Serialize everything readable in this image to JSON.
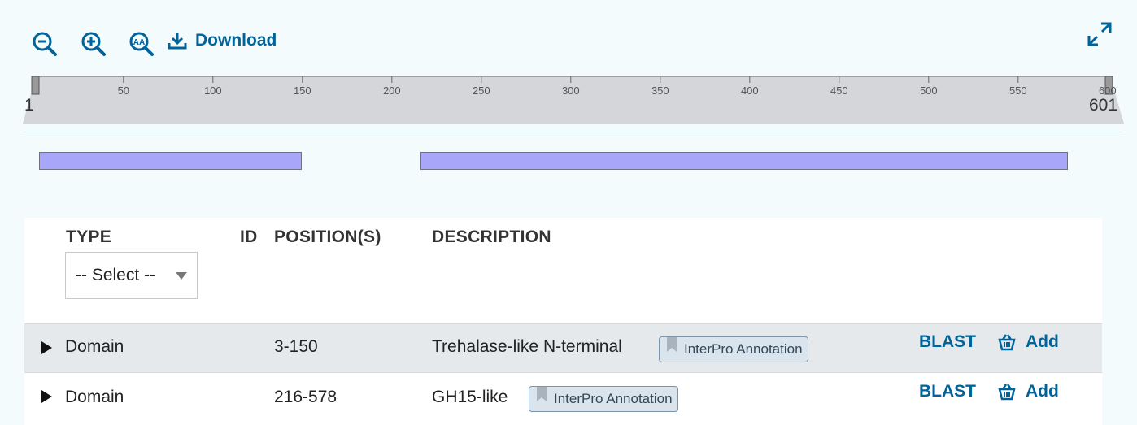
{
  "toolbar": {
    "zoom_out_icon": "zoom-out-icon",
    "zoom_in_icon": "zoom-in-icon",
    "zoom_reset_icon": "zoom-reset-icon",
    "download_label": "Download",
    "download_icon": "download-icon",
    "expand_icon": "expand-icon",
    "accent_color": "#00639a"
  },
  "ruler": {
    "start_label": "1",
    "end_label": "601",
    "ticks": [
      "50",
      "100",
      "150",
      "200",
      "250",
      "300",
      "350",
      "400",
      "450",
      "500",
      "550",
      "600"
    ]
  },
  "track": {
    "features": [
      {
        "start": 3,
        "end": 150
      },
      {
        "start": 216,
        "end": 578
      }
    ],
    "sequence_length": 601,
    "feature_color": "#a8a6f8"
  },
  "table": {
    "headers": {
      "type": "TYPE",
      "id": "ID",
      "positions": "POSITION(S)",
      "description": "DESCRIPTION"
    },
    "type_filter": {
      "selected": "-- Select --"
    },
    "rows": [
      {
        "type": "Domain",
        "id": "",
        "positions": "3-150",
        "description": "Trehalase-like N-terminal",
        "badge": "InterPro Annotation",
        "blast_label": "BLAST",
        "add_label": "Add"
      },
      {
        "type": "Domain",
        "id": "",
        "positions": "216-578",
        "description": "GH15-like",
        "badge": "InterPro Annotation",
        "blast_label": "BLAST",
        "add_label": "Add"
      }
    ]
  }
}
